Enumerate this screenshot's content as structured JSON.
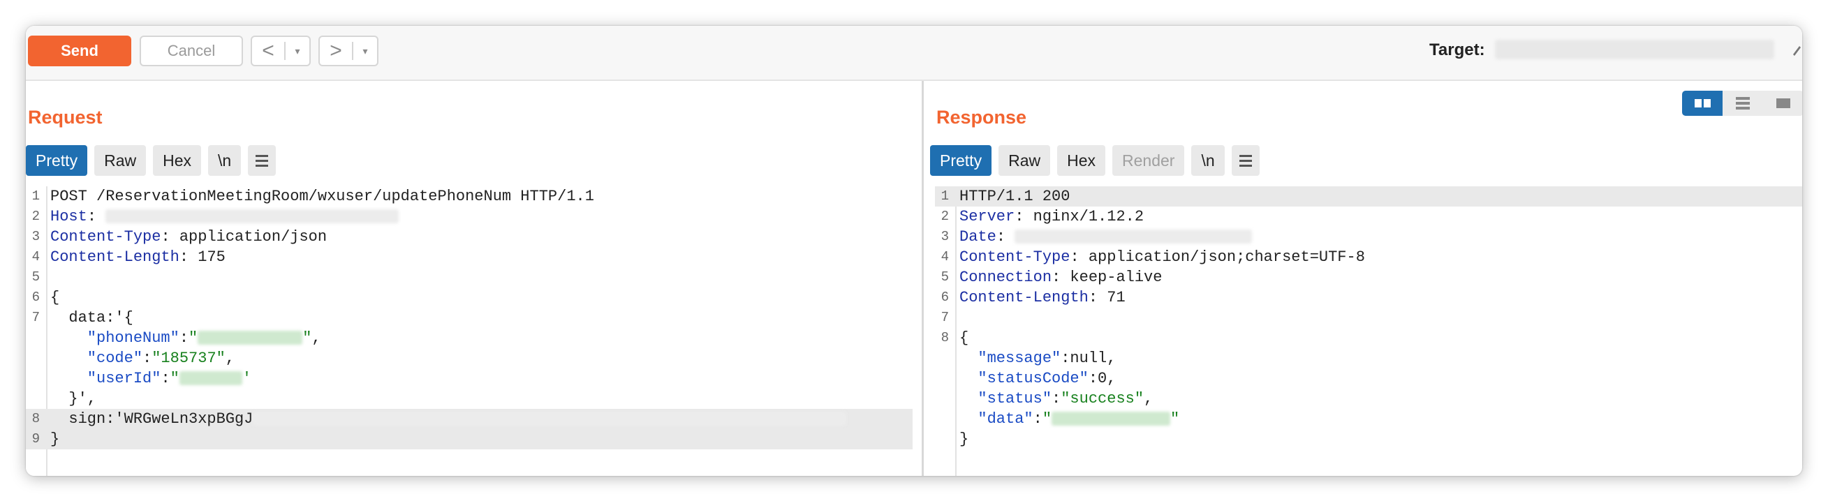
{
  "toolbar": {
    "send_label": "Send",
    "cancel_label": "Cancel",
    "back_arrow": "<",
    "forward_arrow": ">",
    "dropdown_glyph": "▾",
    "target_label": "Target:"
  },
  "request": {
    "title": "Request",
    "tabs": [
      "Pretty",
      "Raw",
      "Hex",
      "\\n"
    ],
    "lines": [
      {
        "n": "1",
        "parts": [
          {
            "t": "POST /ReservationMeetingRoom/wxuser/updatePhoneNum HTTP/1.1",
            "c": ""
          }
        ]
      },
      {
        "n": "2",
        "parts": [
          {
            "t": "Host",
            "c": "k"
          },
          {
            "t": ": ",
            "c": ""
          }
        ],
        "blur": 420
      },
      {
        "n": "3",
        "parts": [
          {
            "t": "Content-Type",
            "c": "k"
          },
          {
            "t": ": application/json",
            "c": ""
          }
        ]
      },
      {
        "n": "4",
        "parts": [
          {
            "t": "Content-Length",
            "c": "k"
          },
          {
            "t": ": 175",
            "c": ""
          }
        ]
      },
      {
        "n": "5",
        "parts": []
      },
      {
        "n": "6",
        "parts": [
          {
            "t": "{",
            "c": ""
          }
        ]
      },
      {
        "n": "7",
        "parts": [
          {
            "t": "  data:'{",
            "c": ""
          }
        ]
      },
      {
        "n": "",
        "parts": [
          {
            "t": "    \"phoneNum\"",
            "c": "sp"
          },
          {
            "t": ":",
            "c": ""
          },
          {
            "t": "\"",
            "c": "s"
          }
        ],
        "blur_green": 150,
        "after": [
          {
            "t": "\"",
            "c": "s"
          },
          {
            "t": ",",
            "c": ""
          }
        ]
      },
      {
        "n": "",
        "parts": [
          {
            "t": "    \"code\"",
            "c": "sp"
          },
          {
            "t": ":",
            "c": ""
          },
          {
            "t": "\"185737\"",
            "c": "s"
          },
          {
            "t": ",",
            "c": ""
          }
        ]
      },
      {
        "n": "",
        "parts": [
          {
            "t": "    \"userId\"",
            "c": "sp"
          },
          {
            "t": ":",
            "c": ""
          },
          {
            "t": "\"",
            "c": "s"
          }
        ],
        "blur_green": 90,
        "after": [
          {
            "t": "'",
            "c": "s"
          }
        ]
      },
      {
        "n": "",
        "parts": [
          {
            "t": "  }',",
            "c": ""
          }
        ]
      },
      {
        "n": "8",
        "parts": [
          {
            "t": "  sign:'WRGweLn3xpBGgJ",
            "c": ""
          }
        ],
        "blur": 850,
        "hl": true
      },
      {
        "n": "9",
        "parts": [
          {
            "t": "}",
            "c": ""
          }
        ],
        "hl": true
      }
    ]
  },
  "response": {
    "title": "Response",
    "tabs": [
      "Pretty",
      "Raw",
      "Hex",
      "Render",
      "\\n"
    ],
    "lines": [
      {
        "n": "1",
        "parts": [
          {
            "t": "HTTP/1.1 200",
            "c": ""
          }
        ],
        "hl": true
      },
      {
        "n": "2",
        "parts": [
          {
            "t": "Server",
            "c": "k"
          },
          {
            "t": ": nginx/1.12.2",
            "c": ""
          }
        ]
      },
      {
        "n": "3",
        "parts": [
          {
            "t": "Date",
            "c": "k"
          },
          {
            "t": ": ",
            "c": ""
          }
        ],
        "blur": 340
      },
      {
        "n": "4",
        "parts": [
          {
            "t": "Content-Type",
            "c": "k"
          },
          {
            "t": ": application/json;charset=UTF-8",
            "c": ""
          }
        ]
      },
      {
        "n": "5",
        "parts": [
          {
            "t": "Connection",
            "c": "k"
          },
          {
            "t": ": keep-alive",
            "c": ""
          }
        ]
      },
      {
        "n": "6",
        "parts": [
          {
            "t": "Content-Length",
            "c": "k"
          },
          {
            "t": ": 71",
            "c": ""
          }
        ]
      },
      {
        "n": "7",
        "parts": []
      },
      {
        "n": "8",
        "parts": [
          {
            "t": "{",
            "c": ""
          }
        ]
      },
      {
        "n": "",
        "parts": [
          {
            "t": "  \"message\"",
            "c": "sp"
          },
          {
            "t": ":null,",
            "c": ""
          }
        ]
      },
      {
        "n": "",
        "parts": [
          {
            "t": "  \"statusCode\"",
            "c": "sp"
          },
          {
            "t": ":0,",
            "c": ""
          }
        ]
      },
      {
        "n": "",
        "parts": [
          {
            "t": "  \"status\"",
            "c": "sp"
          },
          {
            "t": ":",
            "c": ""
          },
          {
            "t": "\"success\"",
            "c": "s"
          },
          {
            "t": ",",
            "c": ""
          }
        ]
      },
      {
        "n": "",
        "parts": [
          {
            "t": "  \"data\"",
            "c": "sp"
          },
          {
            "t": ":",
            "c": ""
          },
          {
            "t": "\"",
            "c": "s"
          }
        ],
        "blur_green": 170,
        "after": [
          {
            "t": "\"",
            "c": "s"
          }
        ]
      },
      {
        "n": "",
        "parts": [
          {
            "t": "}",
            "c": ""
          }
        ]
      }
    ]
  },
  "colors": {
    "accent": "#f26430",
    "tab_active": "#1f6fb1",
    "header_key": "#1c2fa3",
    "json_key": "#1a4bc4",
    "string_value": "#18811e"
  },
  "icons": [
    "menu-icon",
    "edit-icon",
    "layout-columns-icon",
    "layout-rows-icon",
    "layout-single-icon"
  ]
}
